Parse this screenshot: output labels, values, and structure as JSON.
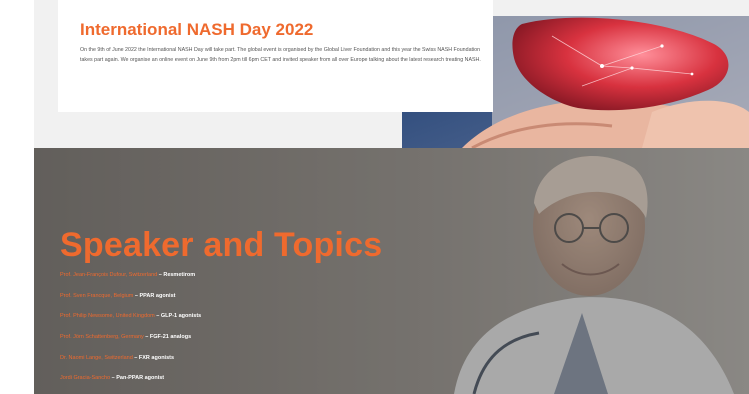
{
  "event": {
    "title": "International NASH Day 2022",
    "description": "On the 9th of June 2022 the International NASH Day will take part. The global event is organised by the Global Liver Foundation and this year the Swiss NASH Foundation takes part again. We organise an online event on June 9th from 2pm till 6pm CET and invited speaker from all over Europe talking about the latest research treating NASH."
  },
  "section": {
    "title": "Speaker and Topics"
  },
  "speakers": [
    {
      "name": "Prof. Jean-François Dufour, Switzerland",
      "sep": " – ",
      "topic": "Resmetirom"
    },
    {
      "name": "Prof. Sven Francque, Belgium",
      "sep": " – ",
      "topic": "PPAR agonist"
    },
    {
      "name": "Prof. Philip Newsome, United Kingdom",
      "sep": " – ",
      "topic": "GLP-1 agonists"
    },
    {
      "name": "Prof. Jörn Schattenberg, Germany",
      "sep": " – ",
      "topic": "FGF-21 analogs"
    },
    {
      "name": "Dr. Naomi Lange, Switzerland",
      "sep": " – ",
      "topic": "FXR agonists"
    },
    {
      "name": "Jordi Gracia-Sancho",
      "sep": " – ",
      "topic": "Pan-PPAR agonist"
    }
  ],
  "colors": {
    "accent": "#ef6a2e",
    "hero_overlay": "#6e6a66",
    "card_bg": "#ffffff",
    "band_bg": "#f1f1f1"
  },
  "images": {
    "liver": "liver-held-in-hands-image",
    "doctor": "smiling-doctor-with-glasses-image"
  }
}
